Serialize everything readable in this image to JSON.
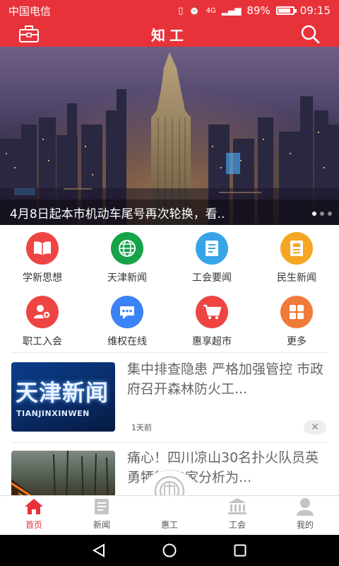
{
  "status_bar": {
    "carrier": "中国电信",
    "signal": "4G",
    "battery": "89%",
    "time": "09:15"
  },
  "header": {
    "title": "知工",
    "left_icon": "briefcase-icon",
    "right_icon": "search-icon"
  },
  "banner": {
    "caption": "4月8日起本市机动车尾号再次轮换，看..",
    "slides": 3,
    "active_slide": 1
  },
  "shortcuts": [
    {
      "label": "学新思想",
      "icon": "book-icon",
      "color": "#ef4444"
    },
    {
      "label": "天津新闻",
      "icon": "globe-icon",
      "color": "#16a34a"
    },
    {
      "label": "工会要闻",
      "icon": "document-icon",
      "color": "#38a4e8"
    },
    {
      "label": "民生新闻",
      "icon": "news-icon",
      "color": "#f5a623"
    },
    {
      "label": "职工入会",
      "icon": "add-user-icon",
      "color": "#ef4444"
    },
    {
      "label": "维权在线",
      "icon": "chat-icon",
      "color": "#3b82f6"
    },
    {
      "label": "惠享超市",
      "icon": "cart-icon",
      "color": "#ef4444"
    },
    {
      "label": "更多",
      "icon": "grid-icon",
      "color": "#f07a3a"
    }
  ],
  "news": [
    {
      "title": "集中排查隐患 严格加强管控 市政府召开森林防火工...",
      "time": "1天前",
      "thumb_title": "天津新闻",
      "thumb_subtitle": "TIANJINXINWEN"
    },
    {
      "title": "痛心！四川凉山30名扑火队员英勇牺牲 专家分析为...",
      "time": ""
    }
  ],
  "bottom_nav": [
    {
      "label": "首页",
      "icon": "home-icon",
      "active": true
    },
    {
      "label": "新闻",
      "icon": "newspaper-icon",
      "active": false
    },
    {
      "label": "惠工",
      "icon": "union-emblem-icon",
      "active": false
    },
    {
      "label": "工会",
      "icon": "bank-icon",
      "active": false
    },
    {
      "label": "我的",
      "icon": "user-icon",
      "active": false
    }
  ],
  "colors": {
    "brand": "#e8323a",
    "muted_icon": "#c4c4c4"
  }
}
